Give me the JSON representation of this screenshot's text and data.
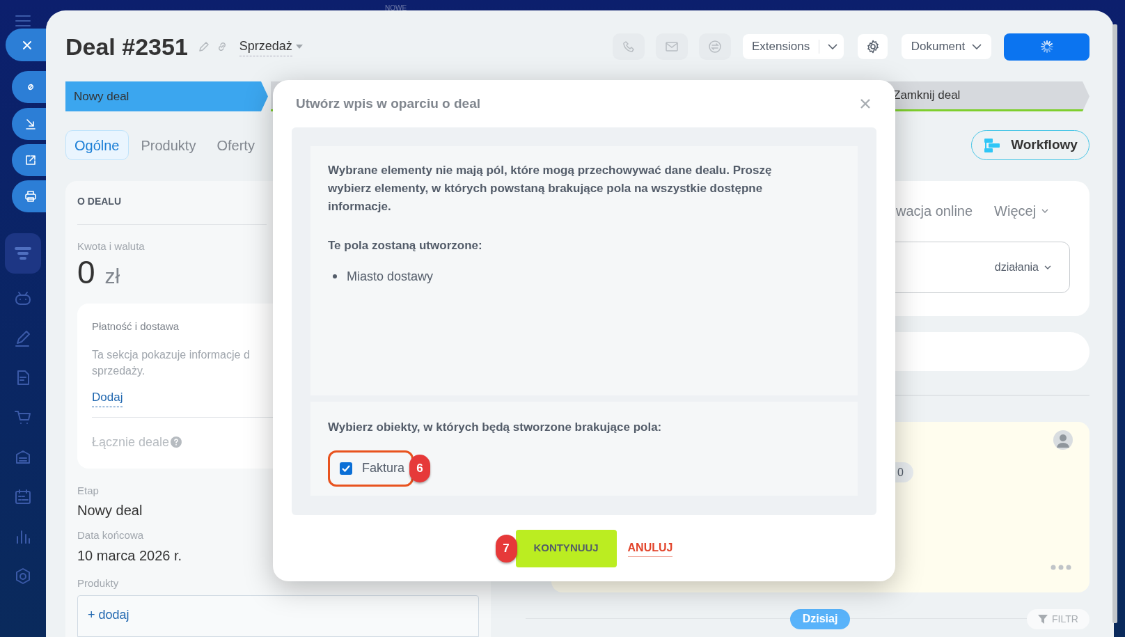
{
  "top_label": "NOWE",
  "header": {
    "title": "Deal #2351",
    "pipeline": "Sprzedaż"
  },
  "toolbar": {
    "extensions": "Extensions",
    "document": "Dokument"
  },
  "stages": [
    {
      "label": "Nowy deal",
      "selected": true
    },
    {
      "label": "Zamknij deal",
      "selected": false
    }
  ],
  "tabs": [
    {
      "label": "Ogólne",
      "selected": true
    },
    {
      "label": "Produkty",
      "selected": false
    },
    {
      "label": "Oferty",
      "selected": false
    }
  ],
  "workflow_button": "Workflowy",
  "deal": {
    "heading": "O DEALU",
    "amount_label": "Kwota i waluta",
    "amount": "0",
    "currency": "zł",
    "payment": {
      "title": "Płatność i dostawa",
      "lines": [
        "Ta sekcja pokazuje informacje d",
        "sprzedaży."
      ],
      "link": "Dodaj",
      "total_label": "Łącznie deale"
    },
    "fields": [
      {
        "label": "Etap",
        "value": "Nowy deal"
      },
      {
        "label": "Data końcowa",
        "value": "10 marca 2026 r."
      }
    ],
    "products_label": "Produkty",
    "products_add": "+ dodaj"
  },
  "activity": {
    "tabs": [
      "wacja online",
      "Więcej"
    ],
    "action": "działania",
    "pill": "0",
    "today": "Dzisiaj",
    "filter": "FILTR"
  },
  "modal": {
    "title": "Utwórz wpis w oparciu o deal",
    "message": "Wybrane elementy nie mają pól, które mogą przechowywać dane dealu. Proszę wybierz elementy, w których powstaną brakujące pola na wszystkie dostępne informacje.",
    "fields_heading": "Te pola zostaną utworzone:",
    "fields": [
      "Miasto dostawy"
    ],
    "objects_heading": "Wybierz obiekty, w których będą stworzone brakujące pola:",
    "objects": [
      {
        "label": "Faktura",
        "checked": true
      }
    ],
    "continue": "KONTYNUUJ",
    "cancel": "ANULUJ",
    "markers": [
      "6",
      "7"
    ]
  }
}
